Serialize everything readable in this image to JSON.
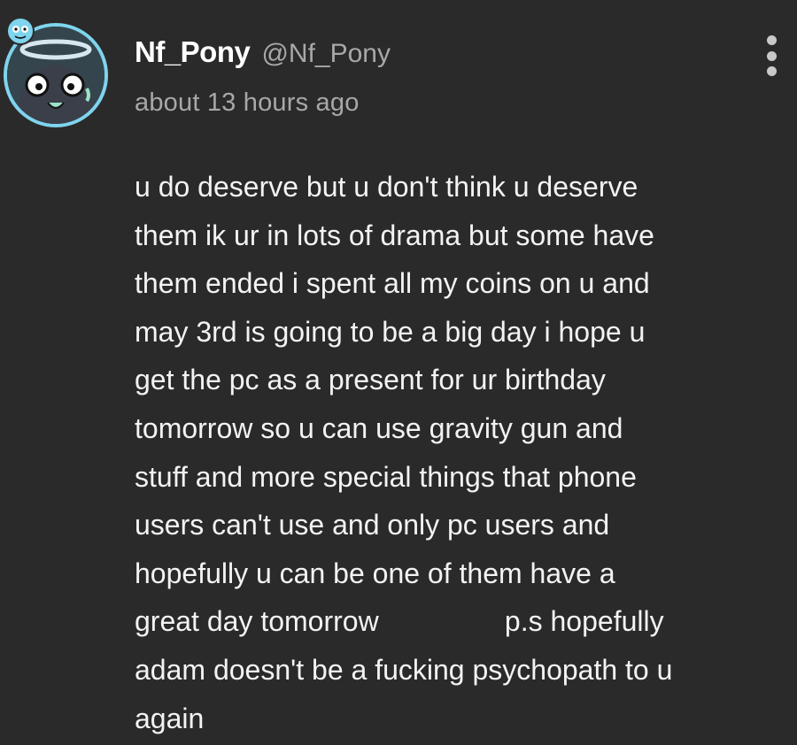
{
  "comment": {
    "author": {
      "username": "Nf_Pony",
      "handle": "@Nf_Pony"
    },
    "timestamp": "about 13 hours ago",
    "body_lines": [
      "u do deserve but u don't think u deserve",
      "them ik ur in lots of drama but some have",
      "them ended i spent all my coins on u and",
      "may 3rd is going to be a big day i hope u",
      "get the pc as a present for ur birthday",
      "tomorrow so u can use gravity gun and",
      "stuff and more special things that phone",
      "users can't use and only pc users and",
      "hopefully u can be one of them have a",
      "great day tomorrow                p.s hopefully",
      "adam doesn't be a fucking psychopath to u",
      "again"
    ]
  },
  "icons": {
    "more": "more-vertical-icon",
    "avatar": "avatar-image",
    "badge": "alien-badge-icon"
  },
  "colors": {
    "background": "#2b2a2a",
    "username": "#ffffff",
    "secondary_text": "#a8a8a8",
    "body_text": "#f3f3f3",
    "avatar_ring": "#7fd4ee"
  }
}
